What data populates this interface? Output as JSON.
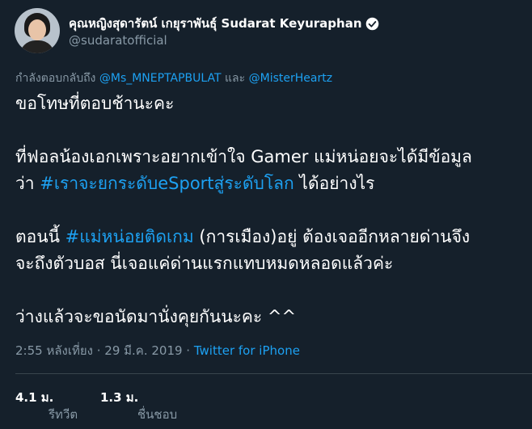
{
  "profile": {
    "display_name": "คุณหญิงสุดารัตน์ เกยุราพันธุ์ Sudarat Keyuraphan",
    "handle": "@sudaratofficial",
    "verified_icon": "verified-badge-icon"
  },
  "reply": {
    "prefix": "กำลังตอบกลับถึง ",
    "user1": "@Ms_MNEPTAPBULAT",
    "conj": " และ ",
    "user2": "@MisterHeartz"
  },
  "tweet": {
    "line1": "ขอโทษที่ตอบช้านะคะ",
    "line2": "ที่ฟอลน้องเอกเพราะอยากเข้าใจ Gamer แม่หน่อยจะได้มีข้อมูล",
    "line3_pre": "ว่า ",
    "line3_tag": "#เราจะยกระดับeSportสู่ระดับโลก",
    "line3_post": " ได้อย่างไร",
    "line4_pre": "ตอนนี้ ",
    "line4_tag": "#แม่หน่อยติดเกม",
    "line4_post": " (การเมือง)อยู่ ต้องเจออีกหลายด่านจึง",
    "line5": "จะถึงตัวบอส นี่เจอแค่ด่านแรกแทบหมดหลอดแล้วค่ะ",
    "line6": "ว่างแล้วจะขอนัดมานั่งคุยกันนะคะ ^^"
  },
  "meta": {
    "timestamp": "2:55 หลังเที่ยง · 29 มี.ค. 2019 · ",
    "source": "Twitter for iPhone"
  },
  "stats": {
    "retweets_count": "4.1 ม.",
    "retweets_label": "รีทวีต",
    "likes_count": "1.3 ม.",
    "likes_label": "ชื่นชอบ"
  },
  "colors": {
    "background": "#15202b",
    "link": "#1da1f2",
    "muted": "#8899a6",
    "text": "#ffffff"
  }
}
